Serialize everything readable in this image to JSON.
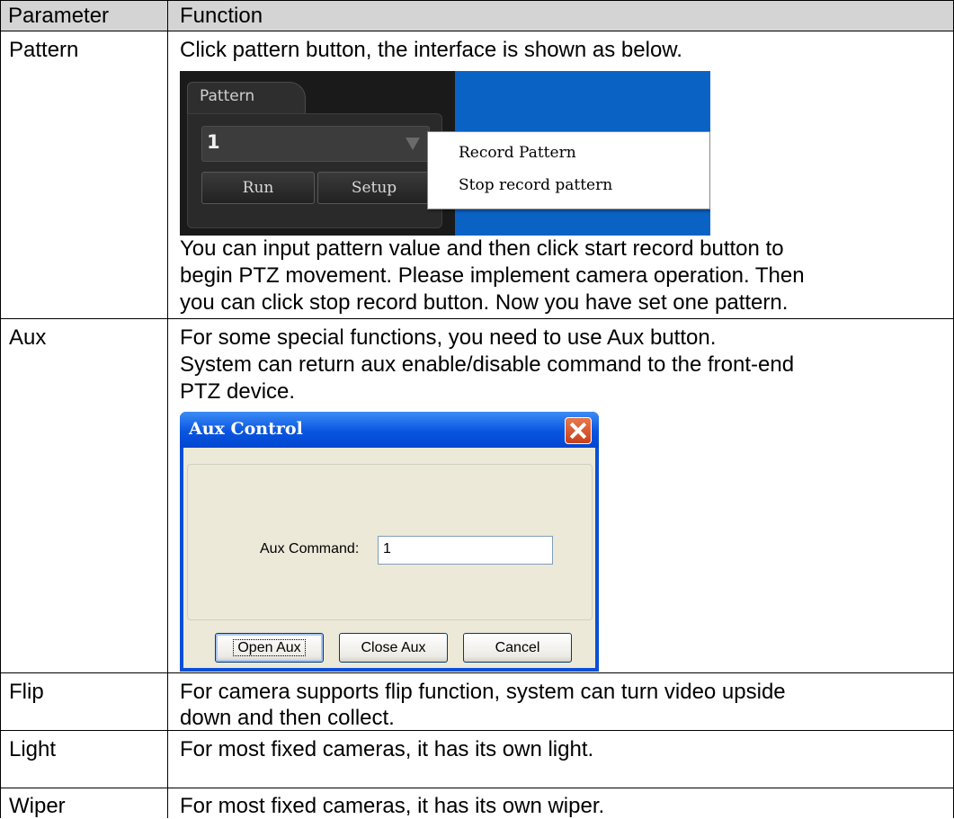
{
  "table": {
    "headers": [
      "Parameter",
      "Function"
    ],
    "rows": [
      {
        "param": "Pattern",
        "lines": [
          "Click pattern button, the interface is shown as below."
        ],
        "after": [
          "You can input pattern value and then click start record button to",
          "begin PTZ movement. Please implement camera operation. Then",
          "you can click stop record button. Now you have set one pattern."
        ]
      },
      {
        "param": "Aux",
        "lines": [
          "For some special functions, you need to use Aux button.",
          "System can return aux enable/disable command to the front-end",
          "PTZ device."
        ]
      },
      {
        "param": "Flip",
        "lines": [
          "For camera supports flip function, system can turn video upside",
          "down and then collect."
        ]
      },
      {
        "param": "Light",
        "lines": [
          "For most fixed cameras, it has its own light."
        ]
      },
      {
        "param": "Wiper",
        "lines": [
          "For most fixed cameras, it has its own wiper."
        ]
      }
    ]
  },
  "pattern_ui": {
    "tab_label": "Pattern",
    "selected_value": "1",
    "run_label": "Run",
    "setup_label": "Setup",
    "menu_items": [
      "Record Pattern",
      "Stop record pattern"
    ]
  },
  "aux_dialog": {
    "title": "Aux Control",
    "command_label": "Aux Command:",
    "command_value": "1",
    "buttons": [
      "Open Aux",
      "Close Aux",
      "Cancel"
    ]
  }
}
